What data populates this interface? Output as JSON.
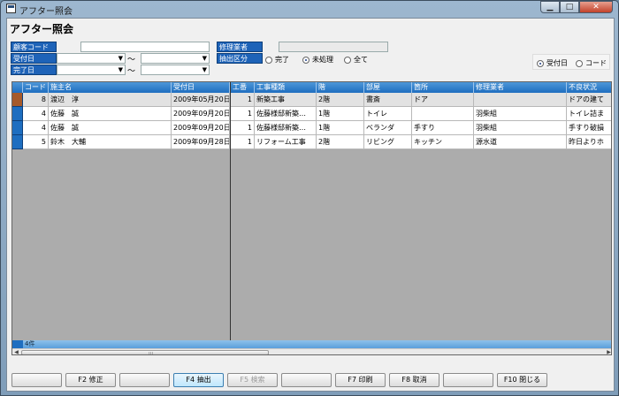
{
  "window": {
    "title": "アフター照会"
  },
  "heading": "アフター照会",
  "filters": {
    "customer_code_label": "顧客コード",
    "accept_date_label": "受付日",
    "complete_date_label": "完了日",
    "contractor_label": "修理業者",
    "extract_label": "抽出区分",
    "tilde": "～",
    "extract_options": [
      {
        "label": "完了",
        "selected": false
      },
      {
        "label": "未処理",
        "selected": true
      },
      {
        "label": "全て",
        "selected": false
      }
    ],
    "sort_options": [
      {
        "label": "受付日",
        "selected": true
      },
      {
        "label": "コード",
        "selected": false
      }
    ]
  },
  "grid": {
    "columns": [
      "",
      "コード",
      "施主名",
      "受付日",
      "工番",
      "工事種類",
      "階",
      "部屋",
      "箇所",
      "修理業者",
      "不良状況"
    ],
    "rows": [
      [
        "8",
        "渡辺　淳",
        "2009年05月20日",
        "1",
        "新築工事",
        "2階",
        "書斎",
        "ドア",
        "",
        "ドアの建て"
      ],
      [
        "4",
        "佐藤　誠",
        "2009年09月20日",
        "1",
        "佐藤様邸新築…",
        "1階",
        "トイレ",
        "",
        "羽柴組",
        "トイレ詰ま"
      ],
      [
        "4",
        "佐藤　誠",
        "2009年09月20日",
        "1",
        "佐藤様邸新築…",
        "1階",
        "ベランダ",
        "手すり",
        "羽柴組",
        "手すり破損"
      ],
      [
        "5",
        "鈴木　大輔",
        "2009年09月28日",
        "1",
        "リフォーム工事",
        "2階",
        "リビング",
        "キッチン",
        "源水道",
        "昨日よりホ"
      ]
    ],
    "count": "4件"
  },
  "function_keys": [
    {
      "label": "",
      "enabled": false
    },
    {
      "label": "F2 修正",
      "enabled": true
    },
    {
      "label": "",
      "enabled": false
    },
    {
      "label": "F4 抽出",
      "enabled": true
    },
    {
      "label": "F5 検索",
      "enabled": false
    },
    {
      "label": "",
      "enabled": false
    },
    {
      "label": "F7 印刷",
      "enabled": true
    },
    {
      "label": "F8 取消",
      "enabled": true
    },
    {
      "label": "",
      "enabled": false
    },
    {
      "label": "F10 閉じる",
      "enabled": true
    }
  ]
}
